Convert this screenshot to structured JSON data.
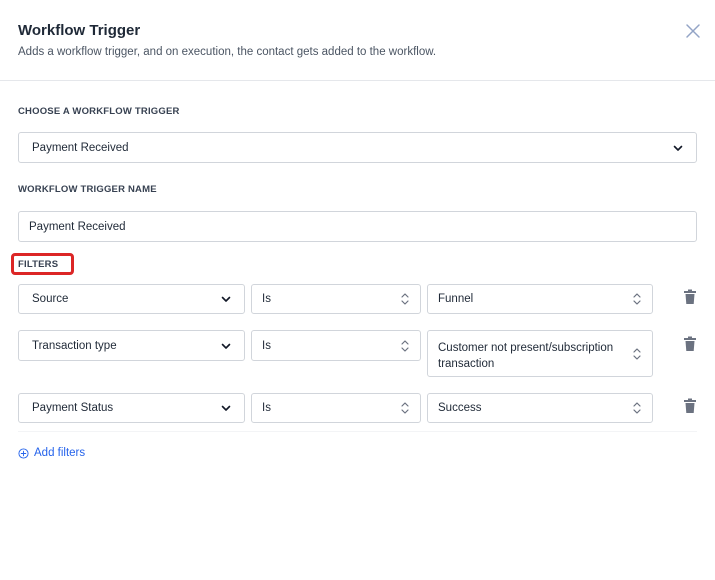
{
  "modal": {
    "title": "Workflow Trigger",
    "subtitle": "Adds a workflow trigger, and on execution, the contact gets added to the workflow."
  },
  "trigger_select": {
    "label": "CHOOSE A WORKFLOW TRIGGER",
    "value": "Payment Received"
  },
  "trigger_name": {
    "label": "WORKFLOW TRIGGER NAME",
    "value": "Payment Received"
  },
  "filters": {
    "label": "FILTERS",
    "rows": [
      {
        "field": "Source",
        "operator": "Is",
        "value": "Funnel"
      },
      {
        "field": "Transaction type",
        "operator": "Is",
        "value": "Customer not present/subscription transaction"
      },
      {
        "field": "Payment Status",
        "operator": "Is",
        "value": "Success"
      }
    ],
    "add_label": "Add filters"
  },
  "colors": {
    "accent": "#2563eb",
    "highlight": "#dc2626",
    "border": "#d1d5db"
  }
}
